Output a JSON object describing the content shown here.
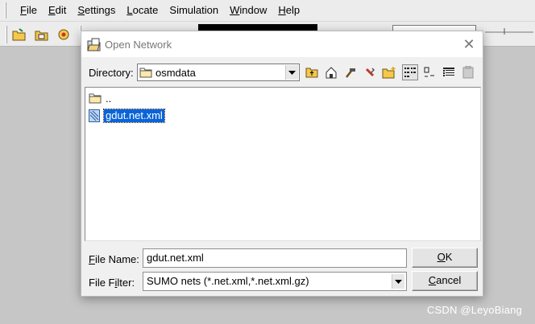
{
  "menubar": {
    "items": [
      {
        "label": "File",
        "accel": "F",
        "rest": "ile"
      },
      {
        "label": "Edit",
        "accel": "E",
        "rest": "dit"
      },
      {
        "label": "Settings",
        "accel": "S",
        "rest": "ettings"
      },
      {
        "label": "Locate",
        "accel": "L",
        "rest": "ocate"
      },
      {
        "label": "Simulation",
        "accel": "",
        "rest": "Simulation"
      },
      {
        "label": "Window",
        "accel": "W",
        "rest": "indow"
      },
      {
        "label": "Help",
        "accel": "H",
        "rest": "elp"
      }
    ]
  },
  "dialog": {
    "title": "Open Network",
    "close_glyph": "✕",
    "directory_label_pre": "Directory:",
    "directory_value": "osmdata",
    "files": [
      {
        "name": "..",
        "kind": "parent-folder"
      },
      {
        "name": "gdut.net.xml",
        "kind": "network-file",
        "selected": true
      }
    ],
    "file_name": {
      "label_accel": "F",
      "label_rest": "ile Name:",
      "value": "gdut.net.xml"
    },
    "file_filter": {
      "label_pre": "File F",
      "label_accel": "i",
      "label_rest": "lter:",
      "value": "SUMO nets (*.net.xml,*.net.xml.gz)"
    },
    "ok_button": {
      "accel": "O",
      "rest": "K"
    },
    "cancel_button": {
      "accel": "C",
      "rest": "ancel"
    }
  },
  "watermark": "CSDN @LeyoBiang",
  "colors": {
    "selection": "#0a64d8",
    "folder": "#f5c84a",
    "workarea": "#c6c6c6"
  }
}
